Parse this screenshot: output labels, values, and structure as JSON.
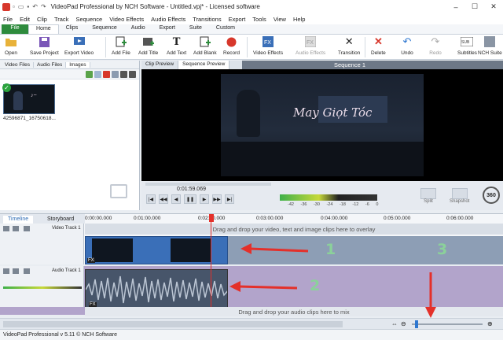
{
  "window": {
    "title": "VideoPad Professional by NCH Software - Untitled.vpj* - Licensed software",
    "controls": [
      "–",
      "☐",
      "✕"
    ]
  },
  "menu": [
    "File",
    "Edit",
    "Clip",
    "Track",
    "Sequence",
    "Video Effects",
    "Audio Effects",
    "Transitions",
    "Export",
    "Tools",
    "View",
    "Help"
  ],
  "ribbon_tabs": [
    "File",
    "Home",
    "Clips",
    "Sequence",
    "Audio",
    "Export",
    "Suite",
    "Custom"
  ],
  "ribbon_buttons": [
    {
      "label": "Open",
      "icon": "folder-icon"
    },
    {
      "label": "Save Project",
      "icon": "save-icon"
    },
    {
      "label": "Export Video",
      "icon": "export-icon"
    },
    {
      "label": "Add File",
      "icon": "add-file-icon"
    },
    {
      "label": "Add Title",
      "icon": "add-title-icon"
    },
    {
      "label": "Add Text",
      "icon": "add-text-icon"
    },
    {
      "label": "Add Blank",
      "icon": "add-blank-icon"
    },
    {
      "label": "Record",
      "icon": "record-icon"
    },
    {
      "label": "Video Effects",
      "icon": "video-effects-icon"
    },
    {
      "label": "Audio Effects",
      "icon": "audio-effects-icon"
    },
    {
      "label": "Transition",
      "icon": "transition-icon"
    },
    {
      "label": "Delete",
      "icon": "delete-icon"
    },
    {
      "label": "Undo",
      "icon": "undo-icon"
    },
    {
      "label": "Redo",
      "icon": "redo-icon"
    },
    {
      "label": "Subtitles",
      "icon": "subtitles-icon"
    },
    {
      "label": "NCH Suite",
      "icon": "nch-suite-icon"
    }
  ],
  "media_tabs": [
    "Video Files",
    "Audio Files",
    "Images"
  ],
  "media_item": {
    "filename": "42596871_16750618..."
  },
  "preview": {
    "tabs": [
      "Clip Preview",
      "Sequence Preview"
    ],
    "title": "Sequence 1",
    "video_text": "May Giọt Tóc",
    "timecode": "0:01:59.069",
    "meter_scale": [
      "-42",
      "-36",
      "-30",
      "-24",
      "-18",
      "-12",
      "-6",
      "0"
    ],
    "buttons": [
      "Split",
      "Snapshot",
      "360"
    ]
  },
  "timeline": {
    "tabs": [
      "Timeline",
      "Storyboard"
    ],
    "ruler": [
      "0:00:00.000",
      "0:01:00.000",
      "0:02:00.000",
      "0:03:00.000",
      "0:04:00.000",
      "0:05:00.000",
      "0:06:00.000"
    ],
    "video_track_name": "Video Track 1",
    "audio_track_name": "Audio Track 1",
    "overlay_hint": "Drag and drop your video, text and image clips here to overlay",
    "mix_hint": "Drag and drop your audio clips here to mix",
    "fx_label": "FX"
  },
  "annotations": [
    "1",
    "2",
    "3"
  ],
  "status": "VideoPad Professional v 5.11 © NCH Software",
  "colors": {
    "file_tab": "#2e8b3d",
    "arrow": "#e4302a",
    "annotation": "#8bd19a",
    "audio_track": "#b2a4cb",
    "video_clip": "#3a6fb8"
  }
}
